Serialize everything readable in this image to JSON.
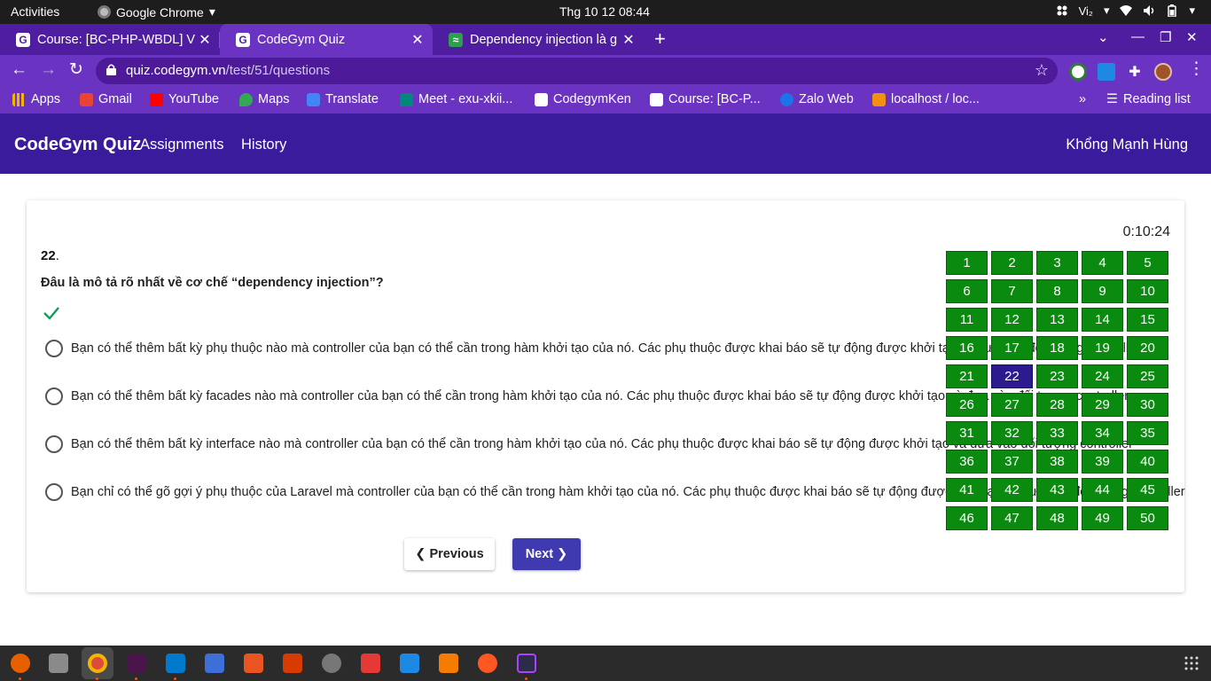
{
  "system_bar": {
    "activities": "Activities",
    "app_name": "Google Chrome",
    "clock": "Thg 10 12  08:44",
    "input_method": "Vi₂",
    "icons": [
      "slack-tray-icon",
      "wifi-icon",
      "volume-icon",
      "battery-icon",
      "power-menu-icon"
    ]
  },
  "browser": {
    "tabs": [
      {
        "title": "Course: [BC-PHP-WBDL] V",
        "favicon": "codegym-g-icon",
        "active": false
      },
      {
        "title": "CodeGym Quiz",
        "favicon": "codegym-g-icon",
        "active": true
      },
      {
        "title": "Dependency injection là g",
        "favicon": "viblo-icon",
        "active": false
      }
    ],
    "url_host": "quiz.codegym.vn",
    "url_path": "/test/51/questions",
    "bookmarks": [
      {
        "label": "Apps",
        "icon": "apps-grid-icon"
      },
      {
        "label": "Gmail",
        "icon": "gmail-icon"
      },
      {
        "label": "YouTube",
        "icon": "youtube-icon"
      },
      {
        "label": "Maps",
        "icon": "maps-icon"
      },
      {
        "label": "Translate",
        "icon": "translate-icon"
      },
      {
        "label": "Meet - exu-xkii...",
        "icon": "meet-icon"
      },
      {
        "label": "CodegymKen",
        "icon": "codegym-g-icon"
      },
      {
        "label": "Course: [BC-P...",
        "icon": "codegym-g-icon"
      },
      {
        "label": "Zalo Web",
        "icon": "zalo-icon"
      },
      {
        "label": "localhost / loc...",
        "icon": "phpmyadmin-icon"
      }
    ],
    "more_bookmarks": "»",
    "reading_list": "Reading list"
  },
  "app": {
    "brand": "CodeGym Quiz",
    "nav": [
      "Assignments",
      "History"
    ],
    "user": "Khổng Mạnh Hùng"
  },
  "quiz": {
    "timer": "0:10:24",
    "question_number": "22",
    "question_suffix": ".",
    "question_text": "Đâu là mô tả rõ nhất về cơ chế “dependency injection”?",
    "answered": true,
    "options": [
      "Bạn có thể thêm bất kỳ phụ thuộc nào mà controller của bạn có thể cần trong hàm khởi tạo của nó. Các phụ thuộc được khai báo sẽ tự động được khởi tạo và đưa vào đối tượng controller",
      "Bạn có thể thêm bất kỳ facades nào mà controller của bạn có thể cần trong hàm khởi tạo của nó. Các phụ thuộc được khai báo sẽ tự động được khởi tạo và đưa vào đối tượng controller",
      "Bạn có thể thêm bất kỳ interface nào mà controller của bạn có thể cần trong hàm khởi tạo của nó. Các phụ thuộc được khai báo sẽ tự động được khởi tạo và đưa vào đối tượng controller",
      "Bạn chỉ có thể gõ gợi ý phụ thuộc của Laravel mà controller của bạn có thể cần trong hàm khởi tạo của nó. Các phụ thuộc được khai báo sẽ tự động được khởi tạo và đưa vào đối tượng controller"
    ],
    "prev_label": "❮ Previous",
    "next_label": "Next ❯",
    "current_question": 22,
    "answered_color": "#0b8a10",
    "current_color": "#2b1b8e",
    "question_numbers": [
      "1",
      "2",
      "3",
      "4",
      "5",
      "6",
      "7",
      "8",
      "9",
      "10",
      "11",
      "12",
      "13",
      "14",
      "15",
      "16",
      "17",
      "18",
      "19",
      "20",
      "21",
      "22",
      "23",
      "24",
      "25",
      "26",
      "27",
      "28",
      "29",
      "30",
      "31",
      "32",
      "33",
      "34",
      "35",
      "36",
      "37",
      "38",
      "39",
      "40",
      "41",
      "42",
      "43",
      "44",
      "45",
      "46",
      "47",
      "48",
      "49",
      "50"
    ]
  },
  "colors": {
    "tabstrip": "#4f1ea0",
    "toolbar": "#6a33c2",
    "app_navbar": "#3a1b9b",
    "next_button": "#3f3ab0"
  }
}
